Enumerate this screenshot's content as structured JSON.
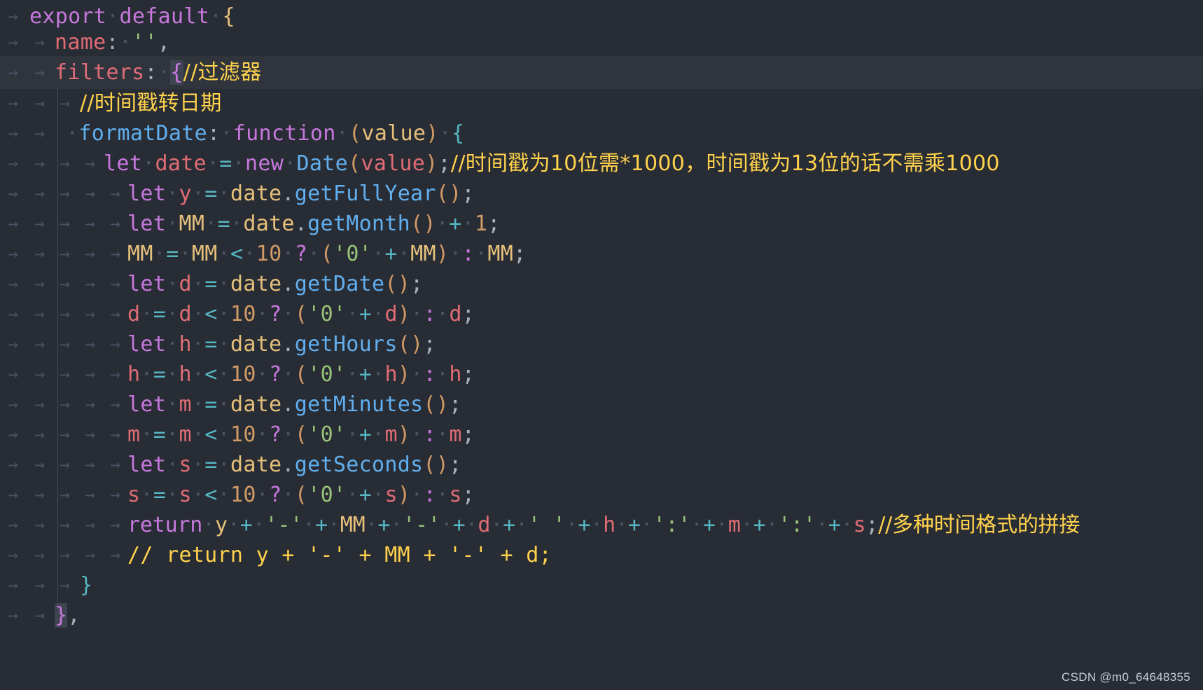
{
  "editor": {
    "watermark": "CSDN @m0_64648355",
    "colors": {
      "background": "#282c34",
      "keyword": "#c678dd",
      "property": "#e06c75",
      "function": "#61afef",
      "string": "#98c379",
      "number": "#d19a66",
      "comment": "#ffd24d"
    },
    "indent_icon": "arrow-right-icon"
  },
  "code": {
    "l1": {
      "t0": "export",
      "t1": "default",
      "t2": "{"
    },
    "l2": {
      "t0": "name",
      "t1": ":",
      "t2": "''",
      "t3": ","
    },
    "l3": {
      "t0": "filters",
      "t1": ":",
      "t2": "{",
      "t3": "//过滤器"
    },
    "l4": {
      "t0": "//时间戳转日期"
    },
    "l5": {
      "t0": "formatDate",
      "t1": ":",
      "t2": "function",
      "t3": "(",
      "t4": "value",
      "t5": ")",
      "t6": "{"
    },
    "l6": {
      "t0": "let",
      "t1": "date",
      "t2": "=",
      "t3": "new",
      "t4": "Date",
      "t5": "(",
      "t6": "value",
      "t7": ")",
      "t8": ";",
      "t9": "//时间戳为10位需*1000，时间戳为13位的话不需乘1000"
    },
    "l7": {
      "t0": "let",
      "t1": "y",
      "t2": "=",
      "t3": "date",
      "t4": ".",
      "t5": "getFullYear",
      "t6": "()",
      "t7": ";"
    },
    "l8": {
      "t0": "let",
      "t1": "MM",
      "t2": "=",
      "t3": "date",
      "t4": ".",
      "t5": "getMonth",
      "t6": "()",
      "t7": "+",
      "t8": "1",
      "t9": ";"
    },
    "l9": {
      "t0": "MM",
      "t1": "=",
      "t2": "MM",
      "t3": "<",
      "t4": "10",
      "t5": "?",
      "t6": "(",
      "t7": "'0'",
      "t8": "+",
      "t9": "MM",
      "t10": ")",
      "t11": ":",
      "t12": "MM",
      "t13": ";"
    },
    "l10": {
      "t0": "let",
      "t1": "d",
      "t2": "=",
      "t3": "date",
      "t4": ".",
      "t5": "getDate",
      "t6": "()",
      "t7": ";"
    },
    "l11": {
      "t0": "d",
      "t1": "=",
      "t2": "d",
      "t3": "<",
      "t4": "10",
      "t5": "?",
      "t6": "(",
      "t7": "'0'",
      "t8": "+",
      "t9": "d",
      "t10": ")",
      "t11": ":",
      "t12": "d",
      "t13": ";"
    },
    "l12": {
      "t0": "let",
      "t1": "h",
      "t2": "=",
      "t3": "date",
      "t4": ".",
      "t5": "getHours",
      "t6": "()",
      "t7": ";"
    },
    "l13": {
      "t0": "h",
      "t1": "=",
      "t2": "h",
      "t3": "<",
      "t4": "10",
      "t5": "?",
      "t6": "(",
      "t7": "'0'",
      "t8": "+",
      "t9": "h",
      "t10": ")",
      "t11": ":",
      "t12": "h",
      "t13": ";"
    },
    "l14": {
      "t0": "let",
      "t1": "m",
      "t2": "=",
      "t3": "date",
      "t4": ".",
      "t5": "getMinutes",
      "t6": "()",
      "t7": ";"
    },
    "l15": {
      "t0": "m",
      "t1": "=",
      "t2": "m",
      "t3": "<",
      "t4": "10",
      "t5": "?",
      "t6": "(",
      "t7": "'0'",
      "t8": "+",
      "t9": "m",
      "t10": ")",
      "t11": ":",
      "t12": "m",
      "t13": ";"
    },
    "l16": {
      "t0": "let",
      "t1": "s",
      "t2": "=",
      "t3": "date",
      "t4": ".",
      "t5": "getSeconds",
      "t6": "()",
      "t7": ";"
    },
    "l17": {
      "t0": "s",
      "t1": "=",
      "t2": "s",
      "t3": "<",
      "t4": "10",
      "t5": "?",
      "t6": "(",
      "t7": "'0'",
      "t8": "+",
      "t9": "s",
      "t10": ")",
      "t11": ":",
      "t12": "s",
      "t13": ";"
    },
    "l18": {
      "t0": "return",
      "t1": "y",
      "t2": "+",
      "t3": "'-'",
      "t4": "+",
      "t5": "MM",
      "t6": "+",
      "t7": "'-'",
      "t8": "+",
      "t9": "d",
      "t10": "+",
      "t11": "' '",
      "t12": "+",
      "t13": "h",
      "t14": "+",
      "t15": "':'",
      "t16": "+",
      "t17": "m",
      "t18": "+",
      "t19": "':'",
      "t20": "+",
      "t21": "s",
      "t22": ";",
      "t23": "//多种时间格式的拼接"
    },
    "l19": {
      "t0": "// return y + '-' + MM + '-' + d;"
    },
    "l20": {
      "t0": "}"
    },
    "l21": {
      "t0": "}",
      "t1": ","
    }
  }
}
